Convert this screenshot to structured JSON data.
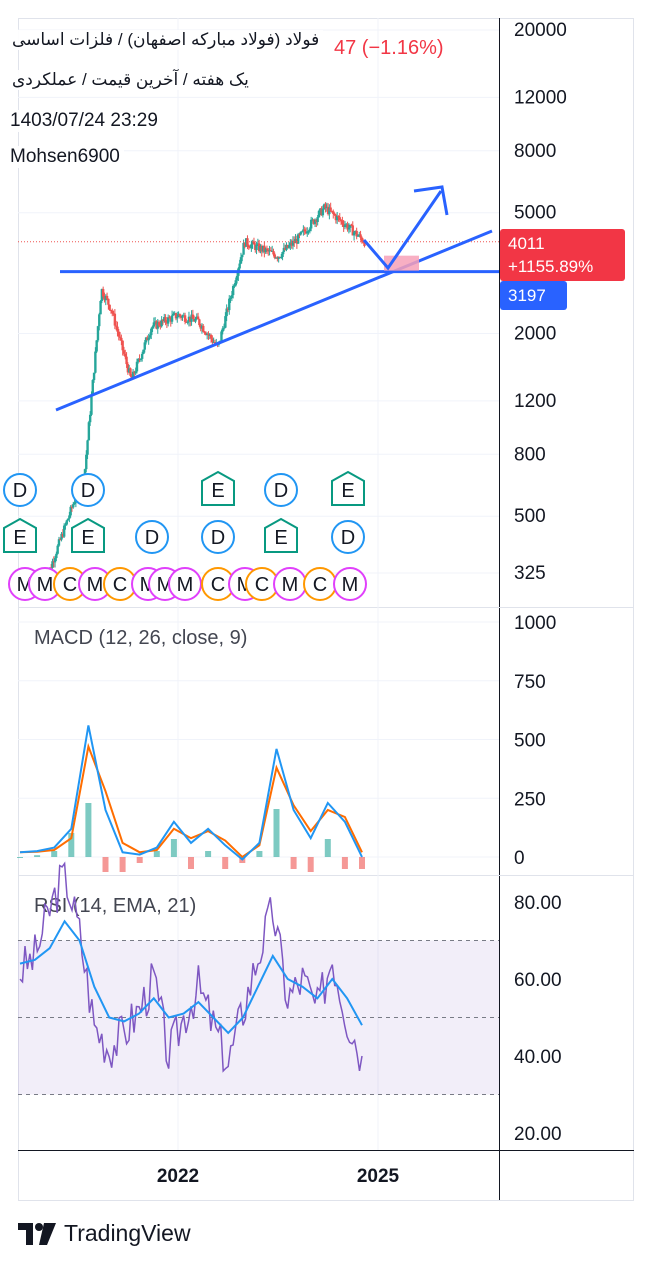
{
  "header": {
    "title": "فولاد (فولاد مبارکه اصفهان) / فلزات اساسی",
    "change_tail": "47 (−1.16%)",
    "subtitle": "یک هفته / آخرین قیمت / عملکردی",
    "timestamp": "1403/07/24 23:29",
    "author": "Mohsen6900"
  },
  "price_tags": {
    "last_price": "4011",
    "last_change": "+1155.89%",
    "level": "3197"
  },
  "colors": {
    "up": "#26a69a",
    "down": "#ef5350",
    "line_blue": "#2962ff",
    "macd": "#2196f3",
    "signal": "#ff6d00",
    "rsi": "#7e57c2",
    "rsi_ema": "#2196f3",
    "last_tag": "#f23645",
    "level_tag": "#2962ff",
    "zone": "#f7a1b8"
  },
  "chart_data": [
    {
      "type": "candlestick",
      "scale": "log",
      "y_ticks": [
        "20000",
        "12000",
        "8000",
        "5000",
        "2000",
        "1200",
        "800",
        "500",
        "325"
      ],
      "x_ticks": [
        "2022",
        "2025"
      ],
      "approx_price_path": [
        [
          2020.0,
          300
        ],
        [
          2020.6,
          700
        ],
        [
          2020.85,
          2800
        ],
        [
          2021.0,
          2400
        ],
        [
          2021.3,
          1400
        ],
        [
          2021.6,
          2100
        ],
        [
          2022.0,
          2300
        ],
        [
          2022.3,
          2200
        ],
        [
          2022.6,
          1800
        ],
        [
          2022.9,
          3300
        ],
        [
          2023.0,
          4000
        ],
        [
          2023.5,
          3600
        ],
        [
          2023.8,
          4100
        ],
        [
          2024.2,
          5200
        ],
        [
          2024.6,
          4400
        ],
        [
          2024.8,
          4011
        ]
      ],
      "horizontal_level": 3197,
      "last_price": 4011,
      "event_markers": [
        "D",
        "E",
        "M",
        "C"
      ]
    },
    {
      "type": "line",
      "title": "MACD (12, 26, close, 9)",
      "y_ticks": [
        "1000",
        "750",
        "500",
        "250",
        "0"
      ],
      "series": [
        {
          "name": "MACD",
          "values": [
            20,
            25,
            40,
            120,
            560,
            200,
            20,
            10,
            40,
            150,
            60,
            120,
            50,
            -10,
            60,
            460,
            200,
            80,
            230,
            150,
            0
          ]
        },
        {
          "name": "signal",
          "values": [
            20,
            22,
            30,
            80,
            470,
            280,
            60,
            20,
            30,
            120,
            80,
            110,
            70,
            0,
            50,
            380,
            220,
            110,
            200,
            170,
            20
          ]
        }
      ]
    },
    {
      "type": "line",
      "title": "RSI (14, EMA, 21)",
      "y_ticks": [
        "80.00",
        "60.00",
        "40.00",
        "20.00"
      ],
      "band": [
        30,
        70
      ],
      "series": [
        {
          "name": "RSI",
          "values": [
            62,
            66,
            78,
            88,
            72,
            48,
            42,
            46,
            52,
            60,
            40,
            50,
            58,
            48,
            38,
            52,
            66,
            78,
            55,
            60,
            52,
            66,
            50,
            40
          ]
        },
        {
          "name": "EMA",
          "values": [
            64,
            65,
            68,
            75,
            70,
            58,
            50,
            49,
            51,
            55,
            50,
            51,
            54,
            50,
            46,
            50,
            58,
            66,
            60,
            58,
            55,
            60,
            55,
            48
          ]
        }
      ]
    }
  ],
  "branding": {
    "logo_text": "TradingView"
  }
}
